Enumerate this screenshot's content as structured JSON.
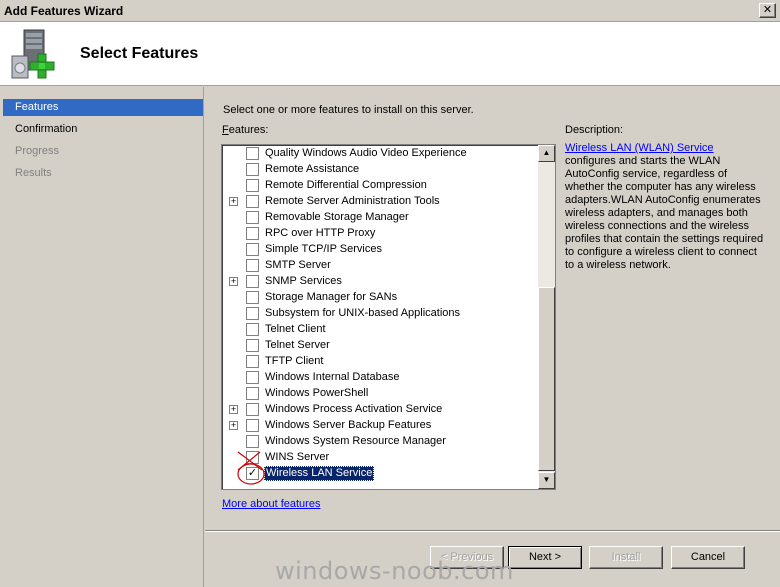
{
  "window": {
    "title": "Add Features Wizard",
    "close_glyph": "✕"
  },
  "header": {
    "title": "Select Features",
    "icon": "server-add-icon"
  },
  "nav": {
    "items": [
      {
        "label": "Features",
        "state": "active"
      },
      {
        "label": "Confirmation",
        "state": "normal"
      },
      {
        "label": "Progress",
        "state": "disabled"
      },
      {
        "label": "Results",
        "state": "disabled"
      }
    ]
  },
  "content": {
    "intro": "Select one or more features to install on this server.",
    "features_label": "Features:",
    "features_label_access": "F",
    "features_label_rest": "eatures:",
    "description_label": "Description:",
    "description_link": "Wireless LAN (WLAN) Service",
    "description_body": "configures and starts the WLAN AutoConfig service, regardless of whether the computer has any wireless adapters.WLAN AutoConfig enumerates wireless adapters, and manages both wireless connections and the wireless profiles that contain the settings required to configure a wireless client to connect to a wireless network.",
    "more_link": "More about features"
  },
  "features": [
    {
      "label": "Quality Windows Audio Video Experience",
      "expandable": false,
      "checked": false
    },
    {
      "label": "Remote Assistance",
      "expandable": false,
      "checked": false
    },
    {
      "label": "Remote Differential Compression",
      "expandable": false,
      "checked": false
    },
    {
      "label": "Remote Server Administration Tools",
      "expandable": true,
      "checked": false
    },
    {
      "label": "Removable Storage Manager",
      "expandable": false,
      "checked": false
    },
    {
      "label": "RPC over HTTP Proxy",
      "expandable": false,
      "checked": false
    },
    {
      "label": "Simple TCP/IP Services",
      "expandable": false,
      "checked": false
    },
    {
      "label": "SMTP Server",
      "expandable": false,
      "checked": false
    },
    {
      "label": "SNMP Services",
      "expandable": true,
      "checked": false
    },
    {
      "label": "Storage Manager for SANs",
      "expandable": false,
      "checked": false
    },
    {
      "label": "Subsystem for UNIX-based Applications",
      "expandable": false,
      "checked": false
    },
    {
      "label": "Telnet Client",
      "expandable": false,
      "checked": false
    },
    {
      "label": "Telnet Server",
      "expandable": false,
      "checked": false
    },
    {
      "label": "TFTP Client",
      "expandable": false,
      "checked": false
    },
    {
      "label": "Windows Internal Database",
      "expandable": false,
      "checked": false
    },
    {
      "label": "Windows PowerShell",
      "expandable": false,
      "checked": false
    },
    {
      "label": "Windows Process Activation Service",
      "expandable": true,
      "checked": false
    },
    {
      "label": "Windows Server Backup Features",
      "expandable": true,
      "checked": false
    },
    {
      "label": "Windows System Resource Manager",
      "expandable": false,
      "checked": false
    },
    {
      "label": "WINS Server",
      "expandable": false,
      "checked": false
    },
    {
      "label": "Wireless LAN Service",
      "expandable": false,
      "checked": true,
      "selected": true
    }
  ],
  "buttons": {
    "previous": "< Previous",
    "next": "Next >",
    "install": "Install",
    "cancel": "Cancel"
  },
  "watermark": "windows-noob.com",
  "colors": {
    "selection": "#0a246a",
    "nav_active": "#316ac5",
    "link": "#0000ff",
    "annotation": "#d00000"
  }
}
